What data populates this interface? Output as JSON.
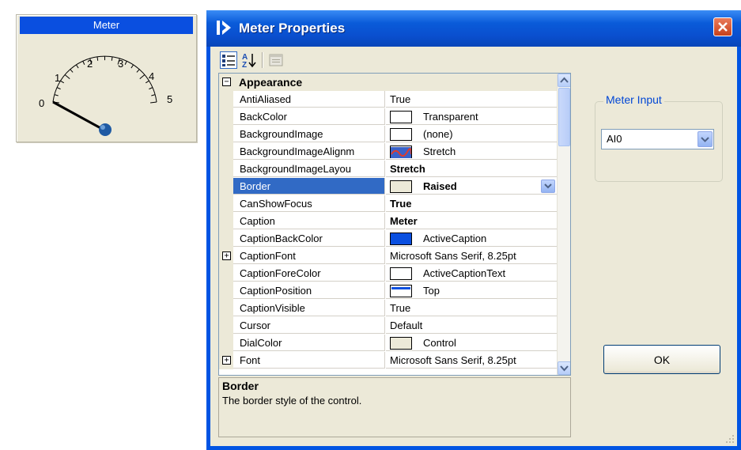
{
  "meter_widget": {
    "caption": "Meter",
    "scale_labels": [
      "0",
      "1",
      "2",
      "3",
      "4",
      "5"
    ]
  },
  "dialog": {
    "title": "Meter Properties",
    "colors": {
      "titlebar": "#0a4fcf",
      "selection": "#316ac5",
      "close": "#c9411c"
    }
  },
  "toolbar": {
    "buttons": [
      {
        "icon": "categorized-icon"
      },
      {
        "icon": "alphabetical-sort-icon"
      },
      {
        "icon": "property-pages-icon"
      }
    ]
  },
  "grid": {
    "category": "Appearance",
    "rows": [
      {
        "name": "AntiAliased",
        "value": "True"
      },
      {
        "name": "BackColor",
        "value": "Transparent",
        "swatch": "#ffffff"
      },
      {
        "name": "BackgroundImage",
        "value": "(none)",
        "swatch": "#ffffff"
      },
      {
        "name": "BackgroundImageAlignm",
        "value": "Stretch",
        "swatch": "image"
      },
      {
        "name": "BackgroundImageLayou",
        "value": "Stretch",
        "bold": true
      },
      {
        "name": "Border",
        "value": "Raised",
        "swatch": "#ece9d8",
        "bold": true,
        "selected": true
      },
      {
        "name": "CanShowFocus",
        "value": "True",
        "bold": true
      },
      {
        "name": "Caption",
        "value": "Meter",
        "bold": true
      },
      {
        "name": "CaptionBackColor",
        "value": "ActiveCaption",
        "swatch": "#0a4fe0"
      },
      {
        "name": "CaptionFont",
        "value": "Microsoft Sans Serif, 8.25pt",
        "expandable": true
      },
      {
        "name": "CaptionForeColor",
        "value": "ActiveCaptionText",
        "swatch": "#ffffff"
      },
      {
        "name": "CaptionPosition",
        "value": "Top",
        "swatch": "top"
      },
      {
        "name": "CaptionVisible",
        "value": "True"
      },
      {
        "name": "Cursor",
        "value": "Default"
      },
      {
        "name": "DialColor",
        "value": "Control",
        "swatch": "#ece9d8"
      },
      {
        "name": "Font",
        "value": "Microsoft Sans Serif, 8.25pt",
        "expandable": true
      }
    ]
  },
  "description": {
    "title": "Border",
    "text": "The border style of the control."
  },
  "meter_input": {
    "label": "Meter Input",
    "selected": "AI0"
  },
  "ok_button": {
    "label": "OK"
  }
}
